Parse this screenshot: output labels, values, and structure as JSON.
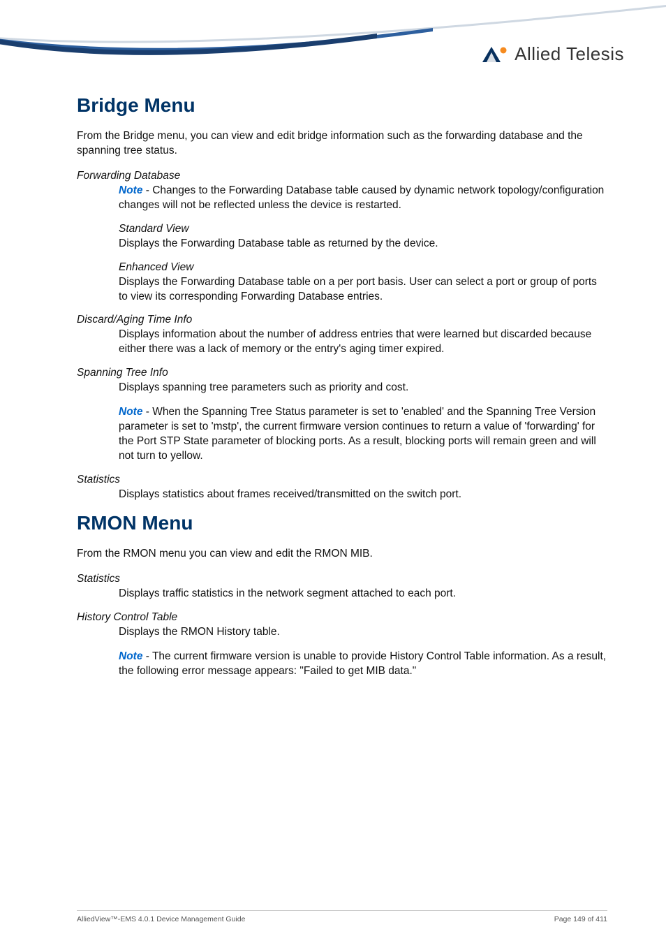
{
  "brand": "Allied Telesis",
  "sections": {
    "bridge": {
      "title": "Bridge Menu",
      "intro": "From the Bridge menu, you can view and edit bridge information such as the forwarding database and the spanning tree status.",
      "forwarding": {
        "label": "Forwarding Database",
        "note_prefix": "Note",
        "note_body": " - Changes to the Forwarding Database table caused by dynamic network topology/configuration changes will not be reflected unless the device is restarted.",
        "standard": {
          "label": "Standard View",
          "body": "Displays the Forwarding Database table as returned by the device."
        },
        "enhanced": {
          "label": "Enhanced View",
          "body": "Displays the Forwarding Database table on a per port basis. User can select a port or group of ports to view its corresponding Forwarding Database entries."
        }
      },
      "discard": {
        "label": "Discard/Aging Time Info",
        "body": "Displays information about the number of address entries that were learned but discarded because either there was a lack of memory or the entry's aging timer expired."
      },
      "spanning": {
        "label": "Spanning Tree Info",
        "body": "Displays spanning tree parameters such as priority and cost.",
        "note_prefix": "Note",
        "note_body": " - When the Spanning Tree Status parameter is set to 'enabled' and the Spanning Tree Version parameter is set to 'mstp', the current firmware version continues to return a value of 'forwarding' for the Port STP State parameter of blocking ports. As a result, blocking ports will remain green and will not turn to yellow."
      },
      "statistics": {
        "label": "Statistics",
        "body": "Displays statistics about frames received/transmitted on the switch port."
      }
    },
    "rmon": {
      "title": "RMON Menu",
      "intro": "From the RMON menu you can view and edit the RMON MIB.",
      "statistics": {
        "label": "Statistics",
        "body": "Displays traffic statistics in the network segment attached to each port."
      },
      "history": {
        "label": "History Control Table",
        "body": "Displays the RMON History table.",
        "note_prefix": "Note",
        "note_body": " - The current firmware version is unable to provide History Control Table information. As a result, the following error message appears: \"Failed to get MIB data.\""
      }
    }
  },
  "footer": {
    "left": "AlliedView™-EMS 4.0.1 Device Management Guide",
    "right": "Page 149 of 411"
  }
}
